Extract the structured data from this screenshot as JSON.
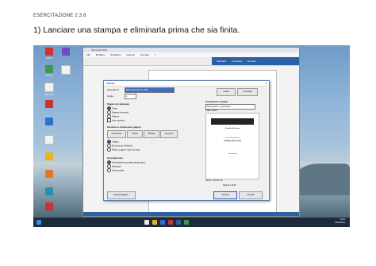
{
  "document": {
    "header": "ESERCITAZIONE 2.3.6",
    "instruction": "1) Lanciare una stampa e eliminarla prima che sia finita."
  },
  "desktop": {
    "icons": [
      {
        "label": "Adobe",
        "color": "red"
      },
      {
        "label": "Excel",
        "color": "green"
      },
      {
        "label": "Microsoft",
        "color": "white"
      },
      {
        "label": "",
        "color": "red"
      },
      {
        "label": "",
        "color": "blue"
      },
      {
        "label": "",
        "color": "white"
      },
      {
        "label": "",
        "color": "yellow"
      },
      {
        "label": "",
        "color": "orange"
      },
      {
        "label": "",
        "color": "teal"
      },
      {
        "label": "",
        "color": "red"
      },
      {
        "label": "",
        "color": "purple"
      },
      {
        "label": "",
        "color": "white"
      }
    ]
  },
  "word": {
    "title": "Microsoft Word",
    "menu": [
      "File",
      "Modifica",
      "Visualizza",
      "Inserisci",
      "Formato",
      "?"
    ],
    "ribbon": [
      "Standard",
      "Completa",
      "Formato"
    ]
  },
  "print_dialog": {
    "title": "Stampa",
    "printer_label": "Stampante:",
    "printer_value": "Microsoft Print to PDF",
    "copies_label": "Copie:",
    "copies_value": "1",
    "pages_label": "Pagine da stampare",
    "pages_options": [
      "Tutte",
      "Pagina corrente",
      "Pagine",
      "Altre opzioni"
    ],
    "size_label": "Gestione e dimensioni pagine",
    "size_buttons": [
      "Dimensioni",
      "Poster",
      "Multiple",
      "Opuscolo"
    ],
    "fit_options": [
      "Adatta",
      "Dimensioni effettive",
      "Riduci pagine fuori formato"
    ],
    "orient_label": "Orientamento:",
    "orient_options": [
      "Verticale/orizzontale automatico",
      "Verticale",
      "Orizzontale"
    ],
    "right_header": "Commenti e moduli",
    "right_value": "Documento e commenti",
    "zoom_text": "Scala: 100%",
    "preview_dims": "209,97 x 297,01 mm",
    "preview_title": "Facoltà di Lettere",
    "preview_lines": [
      "Corso di Laurea in",
      "SCIENZE DELL'ARTE",
      "Documento"
    ],
    "page_counter": "Pagina 1 di 57",
    "buttons": {
      "setup": "Imposta pagina...",
      "print": "Stampa",
      "cancel": "Annulla",
      "help": "Guida",
      "properties": "Proprietà",
      "advanced": "Avanzate"
    }
  },
  "taskbar": {
    "time": "13:01",
    "date": "28/11/2021"
  }
}
